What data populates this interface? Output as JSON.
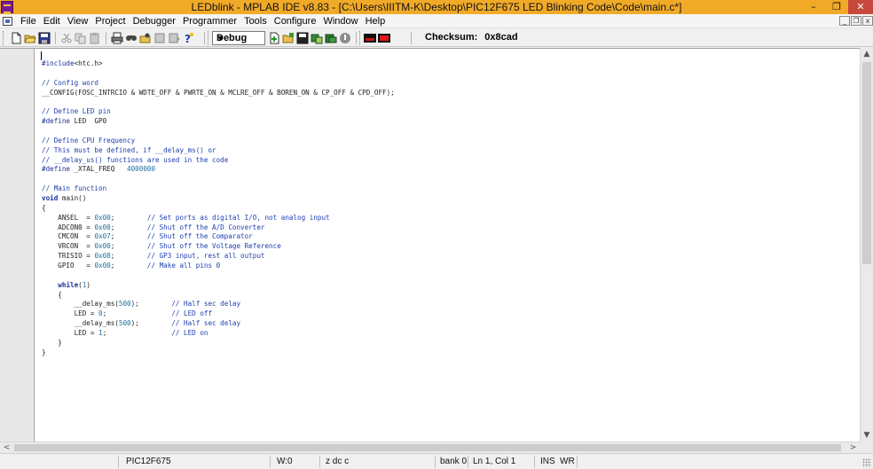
{
  "window": {
    "title": "LEDblink - MPLAB IDE v8.83 - [C:\\Users\\IIITM-K\\Desktop\\PIC12F675 LED Blinking Code\\Code\\main.c*]",
    "controls": {
      "minimize": "–",
      "maximize": "❐",
      "close": "✕"
    }
  },
  "menu": {
    "items": [
      "File",
      "Edit",
      "View",
      "Project",
      "Debugger",
      "Programmer",
      "Tools",
      "Configure",
      "Window",
      "Help"
    ],
    "mdi": {
      "minimize": "_",
      "restore": "❐",
      "close": "x"
    }
  },
  "toolbar": {
    "icons": [
      "new-file-icon",
      "open-folder-icon",
      "save-icon",
      "cut-icon",
      "copy-icon",
      "paste-icon",
      "print-icon",
      "find-icon",
      "find-in-files-icon",
      "bookmark-icon",
      "bookmark-next-icon",
      "help-icon",
      "new-project-icon",
      "open-project-icon",
      "save-project-icon",
      "build-icon",
      "make-icon",
      "stop-icon",
      "device-monitor-icon",
      "programmer-icon"
    ],
    "build_config": "Debug",
    "checksum_label": "Checksum:",
    "checksum_value": "0x8cad"
  },
  "editor": {
    "lines": [
      "#include<htc.h>",
      "",
      "// Config word",
      "__CONFIG(FOSC_INTRCIO & WDTE_OFF & PWRTE_ON & MCLRE_OFF & BOREN_ON & CP_OFF & CPD_OFF);",
      "",
      "// Define LED pin",
      "#define LED  GP0",
      "",
      "// Define CPU Frequency",
      "// This must be defined, if __delay_ms() or",
      "// __delay_us() functions are used in the code",
      "#define _XTAL_FREQ   4000000",
      "",
      "// Main function",
      "void main()",
      "{",
      "    ANSEL  = 0x00;        // Set ports as digital I/O, not analog input",
      "    ADCON0 = 0x00;        // Shut off the A/D Converter",
      "    CMCON  = 0x07;        // Shut off the Comparator",
      "    VRCON  = 0x00;        // Shut off the Voltage Reference",
      "    TRISIO = 0x08;        // GP3 input, rest all output",
      "    GPIO   = 0x00;        // Make all pins 0",
      "",
      "    while(1)",
      "    {",
      "        __delay_ms(500);        // Half sec delay",
      "        LED = 0;                // LED off",
      "        __delay_ms(500);        // Half sec delay",
      "        LED = 1;                // LED on",
      "    }",
      "}"
    ]
  },
  "scrollbars": {
    "up": "▲",
    "down": "▼",
    "left": "<",
    "right": ">"
  },
  "status": {
    "device": "PIC12F675",
    "w_reg": "W:0",
    "flags": "z dc c",
    "bank": "bank 0",
    "position": "Ln 1, Col 1",
    "insert_mode": "INS",
    "write_mode": "WR"
  }
}
